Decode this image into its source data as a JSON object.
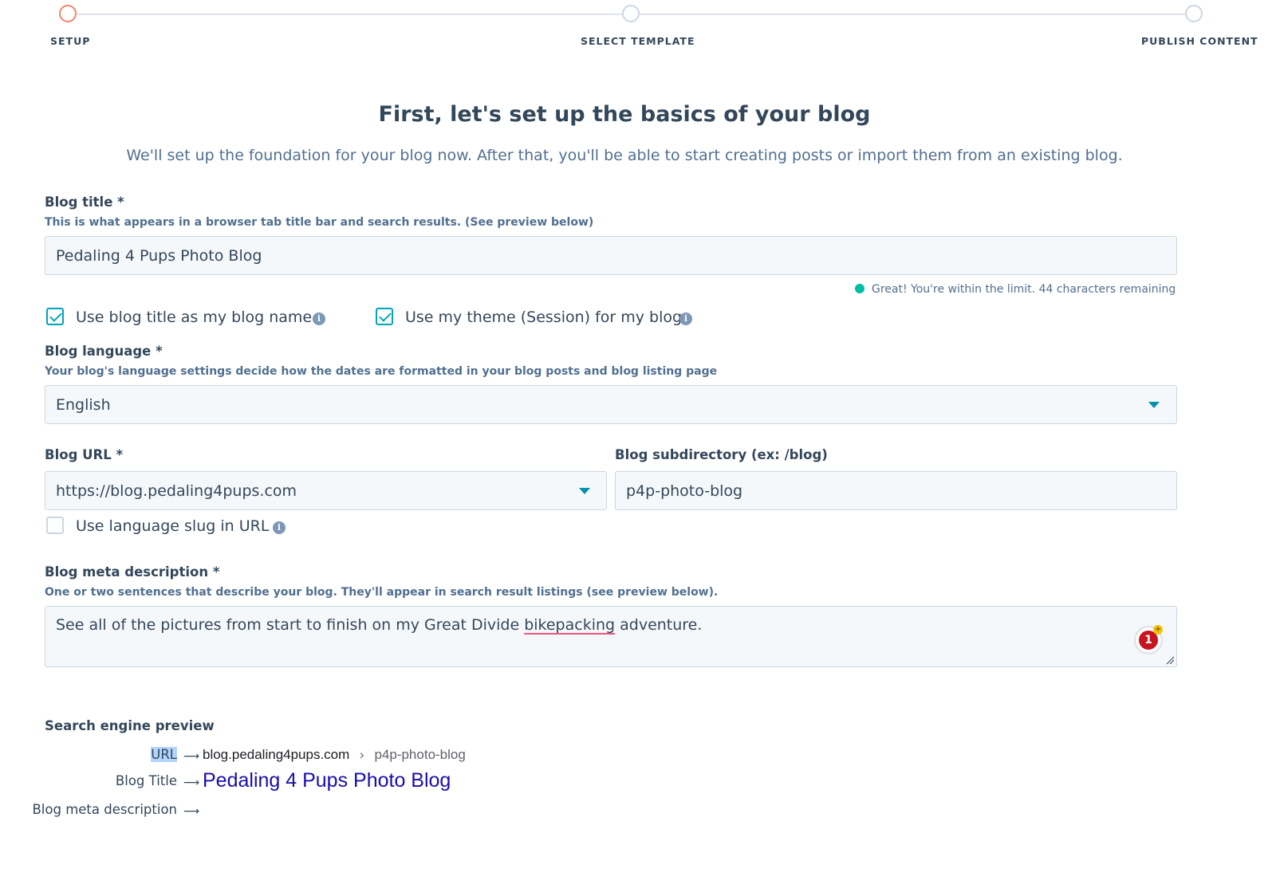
{
  "stepper": {
    "steps": [
      {
        "label": "SETUP",
        "state": "active"
      },
      {
        "label": "SELECT TEMPLATE",
        "state": "pending"
      },
      {
        "label": "PUBLISH CONTENT",
        "state": "pending"
      }
    ]
  },
  "header": {
    "title": "First, let's set up the basics of your blog",
    "subtitle": "We'll set up the foundation for your blog now. After that, you'll be able to start creating posts or import them from an existing blog."
  },
  "blog_title": {
    "label": "Blog title *",
    "help": "This is what appears in a browser tab title bar and search results. (See preview below)",
    "value": "Pedaling 4 Pups Photo Blog",
    "limit_text": "Great! You're within the limit. 44 characters remaining"
  },
  "checkboxes": {
    "use_title_as_name": {
      "label": "Use blog title as my blog name",
      "checked": true
    },
    "use_theme": {
      "label": "Use my theme (Session) for my blog",
      "checked": true
    },
    "use_language_slug": {
      "label": "Use language slug in URL",
      "checked": false
    }
  },
  "blog_language": {
    "label": "Blog language *",
    "help": "Your blog's language settings decide how the dates are formatted in your blog posts and blog listing page",
    "value": "English"
  },
  "blog_url": {
    "label": "Blog URL *",
    "value": "https://blog.pedaling4pups.com"
  },
  "blog_subdirectory": {
    "label": "Blog subdirectory (ex: /blog)",
    "value": "p4p-photo-blog"
  },
  "meta_description": {
    "label": "Blog meta description *",
    "help": "One or two sentences that describe your blog. They'll appear in search result listings (see preview below).",
    "value_before": "See all of the pictures from start to finish on my Great Divide ",
    "value_flagged": "bikepacking",
    "value_after": " adventure.",
    "grammar_count": "1",
    "grammar_plus": "+"
  },
  "preview": {
    "title": "Search engine preview",
    "url_label": "URL",
    "url_domain": "blog.pedaling4pups.com",
    "url_separator": "›",
    "url_path": "p4p-photo-blog",
    "title_label": "Blog Title",
    "title_value": "Pedaling 4 Pups Photo Blog",
    "meta_label": "Blog meta description",
    "arrow": "⟶"
  },
  "colors": {
    "accent": "#00a4bd",
    "active_step": "#f2836b",
    "success": "#00bda5",
    "link_blue": "#1a0dab",
    "text": "#33475b"
  }
}
